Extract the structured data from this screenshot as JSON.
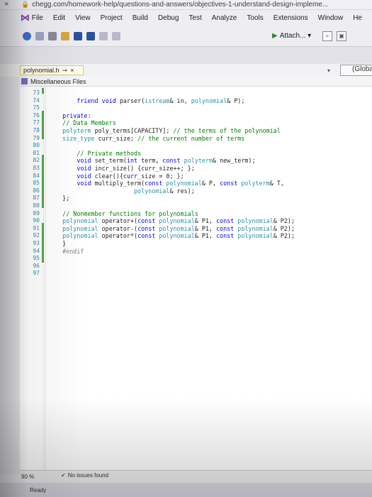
{
  "browser": {
    "url": "chegg.com/homework-help/questions-and-answers/objectives-1-understand-design-impleme..."
  },
  "menu": {
    "items": [
      "File",
      "Edit",
      "View",
      "Project",
      "Build",
      "Debug",
      "Test",
      "Analyze",
      "Tools",
      "Extensions",
      "Window",
      "He"
    ]
  },
  "toolbar": {
    "attach_label": "Attach...",
    "attach_icon": "play-icon"
  },
  "document_tab": {
    "filename": "polynomial.h",
    "pin_icon": "pin-icon",
    "close_label": "×"
  },
  "scope_dropdown": {
    "value": "(Globa"
  },
  "context": {
    "project": "Miscellaneous Files"
  },
  "code": {
    "line_numbers": [
      "73",
      "74",
      "75",
      "76",
      "77",
      "78",
      "79",
      "80",
      "81",
      "82",
      "83",
      "84",
      "85",
      "86",
      "87",
      "88",
      "89",
      "90",
      "91",
      "92",
      "93",
      "94",
      "95",
      "96",
      "97"
    ]
  },
  "status": {
    "zoom": "90 %",
    "issues": "No issues found",
    "ready": "Ready"
  },
  "colors": {
    "keyword": "#0000ff",
    "type": "#2b91af",
    "comment": "#008000",
    "preprocessor": "#808080"
  }
}
